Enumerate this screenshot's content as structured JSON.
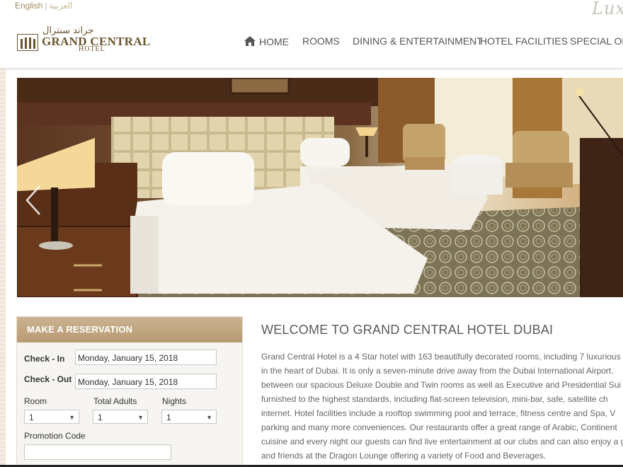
{
  "language": {
    "english": "English",
    "separator": "|",
    "arabic": "العربية"
  },
  "brand": {
    "tagline_partial": "Lux",
    "arabic_name": "جراند سنترال",
    "name": "GRAND CENTRAL",
    "sub": "HOTEL"
  },
  "nav": {
    "items": [
      "HOME",
      "ROOMS",
      "DINING & ENTERTAINMENT",
      "HOTEL FACILITIES",
      "SPECIAL OFFE"
    ]
  },
  "reservation": {
    "title": "MAKE A RESERVATION",
    "checkin_label": "Check - In",
    "checkin_value": "Monday, January 15, 2018",
    "checkout_label": "Check - Out",
    "checkout_value": "Monday, January 15, 2018",
    "room_label": "Room",
    "room_value": "1",
    "adults_label": "Total Adults",
    "adults_value": "1",
    "nights_label": "Nights",
    "nights_value": "1",
    "promo_label": "Promotion Code",
    "promo_value": ""
  },
  "welcome": {
    "title": "WELCOME TO GRAND CENTRAL HOTEL DUBAI",
    "lines": [
      "Grand Central Hotel is a 4 Star hotel with 163 beautifully decorated rooms, including 7 luxurious",
      "in the heart of Dubai. It is only a seven-minute drive away from the Dubai International Airport.",
      "between our spacious Deluxe Double and Twin rooms as well as Executive and Presidential Sui",
      "furnished to the highest standards, including flat-screen television, mini-bar, safe, satellite ch",
      "internet. Hotel facilities include a rooftop swimming pool and terrace, fitness centre and Spa, V",
      "parking and many more conveniences. Our restaurants offer a great range of Arabic, Continent",
      "cuisine and every night our guests can find live entertainment at our clubs and can also enjoy a g",
      "and friends at the Dragon Lounge offering a variety of Food and Beverages."
    ]
  },
  "icons": {
    "home": "home-icon",
    "prev": "chevron-left-icon",
    "caret": "caret-down-icon"
  },
  "colors": {
    "gold": "#a08a5c",
    "brown": "#6b5530",
    "header_tan": "#bfa27c"
  }
}
